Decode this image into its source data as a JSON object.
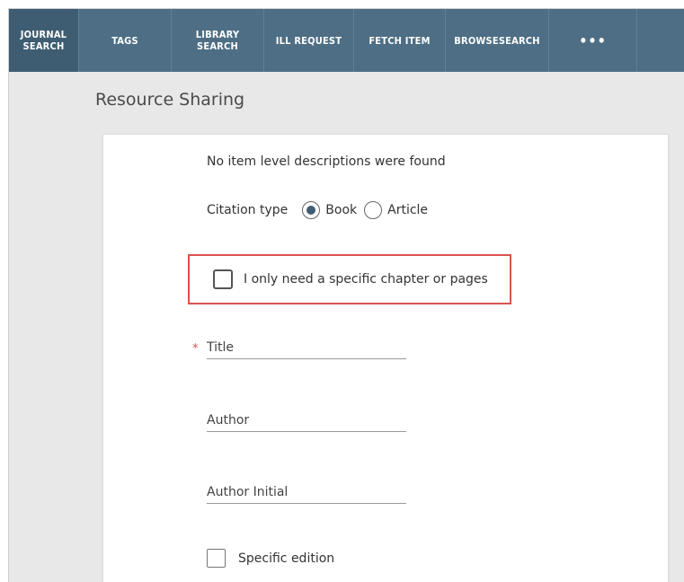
{
  "nav": {
    "items": [
      {
        "label": "JOURNAL\nSEARCH"
      },
      {
        "label": "TAGS"
      },
      {
        "label": "LIBRARY\nSEARCH"
      },
      {
        "label": "ILL REQUEST"
      },
      {
        "label": "FETCH ITEM"
      },
      {
        "label": "BROWSESEARCH"
      },
      {
        "label": "•••"
      }
    ]
  },
  "page": {
    "title": "Resource Sharing"
  },
  "form": {
    "notice": "No item level descriptions were found",
    "citation_type_label": "Citation type",
    "citation_options": [
      {
        "label": "Book",
        "selected": true
      },
      {
        "label": "Article",
        "selected": false
      }
    ],
    "chapter_checkbox_label": "I only need a specific chapter or pages",
    "required_marker": "*",
    "fields": {
      "title": "Title",
      "author": "Author",
      "author_initial": "Author Initial"
    },
    "edition_checkbox_label": "Specific edition"
  },
  "colors": {
    "navbar": "#4d6e84",
    "highlight": "#d9534f",
    "radio_selected": "#3f5d72"
  }
}
